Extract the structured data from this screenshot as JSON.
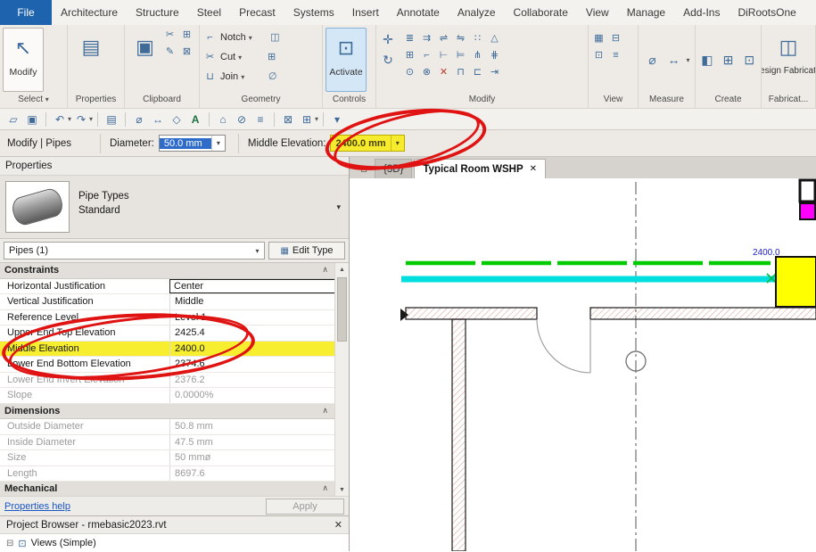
{
  "ui": {
    "caret_down": "▾",
    "chevron_collapse": "∧",
    "close": "✕",
    "scroll_up": "▲",
    "scroll_down": "▼"
  },
  "ribbon": {
    "file_tab": "File",
    "tabs": [
      "Architecture",
      "Structure",
      "Steel",
      "Precast",
      "Systems",
      "Insert",
      "Annotate",
      "Analyze",
      "Collaborate",
      "View",
      "Manage",
      "Add-Ins",
      "DiRootsOne"
    ],
    "select": {
      "label": "Select",
      "modify_label": "Modify",
      "modify_icon": "↖"
    },
    "properties": {
      "label": "Properties",
      "icon": "▤"
    },
    "clipboard": {
      "label": "Clipboard",
      "paste_icon": "▣",
      "tools": [
        {
          "glyph": "✂"
        },
        {
          "glyph": "⊞"
        },
        {
          "glyph": "✎"
        },
        {
          "glyph": "⊠"
        }
      ]
    },
    "geometry": {
      "label": "Geometry",
      "rows": [
        {
          "glyph": "⌐",
          "label": "Notch"
        },
        {
          "glyph": "✂",
          "label": "Cut"
        },
        {
          "glyph": "⊔",
          "label": "Join"
        }
      ],
      "side": [
        {
          "glyph": "◫"
        },
        {
          "glyph": "⊞"
        },
        {
          "glyph": "∅"
        }
      ]
    },
    "controls": {
      "label": "Controls",
      "activate_label": "Activate",
      "activate_icon": "⊡"
    },
    "modify_panel": {
      "label": "Modify",
      "left": [
        {
          "glyph": "✛"
        },
        {
          "glyph": "↻"
        }
      ],
      "grid": [
        {
          "glyph": "≣"
        },
        {
          "glyph": "⇉"
        },
        {
          "glyph": "⇌"
        },
        {
          "glyph": "⇋"
        },
        {
          "glyph": "∷"
        },
        {
          "glyph": "△"
        },
        {
          "glyph": "⊞"
        },
        {
          "glyph": "⌐"
        },
        {
          "glyph": "⊢"
        },
        {
          "glyph": "⊨"
        },
        {
          "glyph": "⋔"
        },
        {
          "glyph": "⋕"
        },
        {
          "glyph": "⊙"
        },
        {
          "glyph": "⊗"
        },
        {
          "glyph": "✕"
        },
        {
          "glyph": "⊓"
        },
        {
          "glyph": "⊏"
        },
        {
          "glyph": "⇥"
        }
      ]
    },
    "view_panel": {
      "label": "View",
      "tools": [
        {
          "glyph": "▦"
        },
        {
          "glyph": "⊟"
        },
        {
          "glyph": "⊡"
        },
        {
          "glyph": "≡"
        }
      ]
    },
    "measure": {
      "label": "Measure",
      "tools": [
        {
          "glyph": "⌀"
        },
        {
          "glyph": "↔"
        }
      ]
    },
    "create": {
      "label": "Create",
      "tools": [
        {
          "glyph": "◧"
        },
        {
          "glyph": "⊞"
        },
        {
          "glyph": "⊡"
        }
      ]
    },
    "fabrication": {
      "label": "Fabricat...",
      "design_label": "Design Fabricat...",
      "design_icon": "◫"
    }
  },
  "qat": {
    "items": [
      {
        "glyph": "▱"
      },
      {
        "glyph": "▣"
      },
      {
        "glyph": "↶"
      },
      {
        "glyph": "↷"
      },
      {
        "glyph": "▤"
      },
      {
        "glyph": "⌀"
      },
      {
        "glyph": "↔"
      },
      {
        "glyph": "◇"
      },
      {
        "glyph": "A"
      },
      {
        "glyph": "⌂"
      },
      {
        "glyph": "⊘"
      },
      {
        "glyph": "≡"
      },
      {
        "glyph": "⊠"
      },
      {
        "glyph": "⊞"
      },
      {
        "glyph": "▾"
      }
    ]
  },
  "options_bar": {
    "context": "Modify | Pipes",
    "diameter_label": "Diameter:",
    "diameter_value": "50.0 mm",
    "elevation_label": "Middle Elevation:",
    "elevation_value": "2400.0 mm"
  },
  "view_tabs": {
    "home_icon": "⌂",
    "tab_3d": "{3D}",
    "tab_active": "Typical Room WSHP"
  },
  "properties_palette": {
    "title": "Properties",
    "type_selector": {
      "family": "Pipe Types",
      "type": "Standard"
    },
    "filter": {
      "value": "Pipes (1)",
      "edit_type_label": "Edit Type",
      "edit_type_icon": "▦"
    },
    "sections": {
      "constraints": "Constraints",
      "dimensions": "Dimensions",
      "mechanical": "Mechanical"
    },
    "rows": [
      {
        "label": "Horizontal Justification",
        "value": "Center"
      },
      {
        "label": "Vertical Justification",
        "value": "Middle"
      },
      {
        "label": "Reference Level",
        "value": "Level 1"
      },
      {
        "label": "Upper End Top Elevation",
        "value": "2425.4"
      },
      {
        "label": "Middle Elevation",
        "value": "2400.0"
      },
      {
        "label": "Lower End Bottom Elevation",
        "value": "2374.6"
      },
      {
        "label": "Lower End Invert Elevation",
        "value": "2376.2"
      },
      {
        "label": "Slope",
        "value": "0.0000%"
      },
      {
        "label": "Outside Diameter",
        "value": "50.8 mm"
      },
      {
        "label": "Inside Diameter",
        "value": "47.5 mm"
      },
      {
        "label": "Size",
        "value": "50 mmø"
      },
      {
        "label": "Length",
        "value": "8697.6"
      }
    ],
    "help_link": "Properties help",
    "apply_label": "Apply"
  },
  "project_browser": {
    "title": "Project Browser - rmebasic2023.rvt",
    "tree_expand": "⊟",
    "item_icon": "⊡",
    "item": "Views (Simple)"
  },
  "drawing": {
    "elevation_tag": "2400.0"
  },
  "colors": {
    "accent_blue": "#1e63ae",
    "selection_blue": "#2f6cc9",
    "highlight_yellow": "#f6ee2f",
    "annotation_red": "#e01313",
    "pipe_green": "#00cc00",
    "pipe_cyan": "#00dede",
    "tag_yellow": "#ffff00",
    "magenta": "#ff00ff",
    "tag_text_blue": "#2020cc"
  }
}
